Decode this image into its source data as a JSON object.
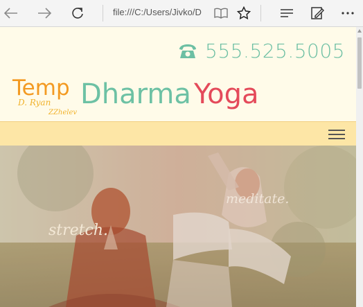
{
  "browser": {
    "address": "file:///C:/Users/Jivko/D",
    "icons": [
      "back-arrow-icon",
      "forward-arrow-icon",
      "refresh-icon",
      "reading-view-icon",
      "favorite-star-icon",
      "hub-icon",
      "web-note-icon",
      "more-icon"
    ]
  },
  "header": {
    "phone": "555.525.5005",
    "logo": {
      "temp": "Temp",
      "dharma": "Dharma",
      "yoga": "Yoga",
      "signature_line1": "D. Ryan",
      "signature_line2": "ZZhelev"
    }
  },
  "hero": {
    "caption_left": "stretch.",
    "caption_right": "meditate."
  },
  "colors": {
    "phone": "#6cbfa3",
    "temp": "#f39a22",
    "dharma": "#6dc1a4",
    "yoga": "#e44a5a",
    "navbar": "#fde6a6",
    "page_bg": "#fffbe9"
  }
}
